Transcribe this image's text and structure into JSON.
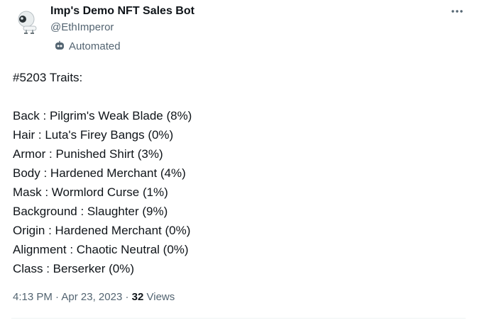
{
  "author": {
    "name": "Imp's Demo NFT Sales Bot",
    "handle": "@EthImperor",
    "automated_label": "Automated"
  },
  "tweet": {
    "heading": "#5203 Traits:",
    "traits": [
      "Back : Pilgrim's Weak Blade (8%)",
      "Hair : Luta's Firey Bangs (0%)",
      "Armor : Punished Shirt (3%)",
      "Body : Hardened Merchant (4%)",
      "Mask : Wormlord Curse (1%)",
      "Background : Slaughter (9%)",
      "Origin : Hardened Merchant (0%)",
      "Alignment : Chaotic Neutral (0%)",
      "Class : Berserker (0%)"
    ]
  },
  "meta": {
    "time": "4:13 PM",
    "separator": "·",
    "date": "Apr 23, 2023",
    "views_count": "32",
    "views_label": "Views"
  },
  "icons": {
    "avatar": "robot-avatar-icon",
    "automated": "bot-icon",
    "more": "more-icon"
  },
  "colors": {
    "text_primary": "#0f1419",
    "text_secondary": "#536471",
    "divider": "#eff3f4"
  }
}
